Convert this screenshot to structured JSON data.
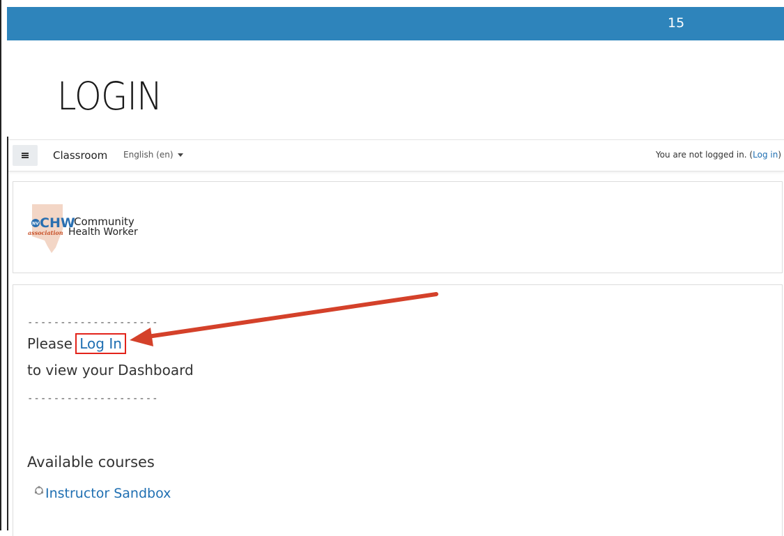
{
  "slide": {
    "number": "15",
    "title": "LOGIN",
    "accent_color": "#2e84bb"
  },
  "navbar": {
    "menu_icon": "hamburger-icon",
    "brand": "Classroom",
    "language": "English (en)",
    "status_text": "You are not logged in. (",
    "status_link": "Log in",
    "status_suffix": ")"
  },
  "logo": {
    "abbrev": "CHW",
    "badge": "NV",
    "tagline": "association",
    "line1": "Community",
    "line2": "Health Worker"
  },
  "main": {
    "dashes_top": "--------------------",
    "please": "Please",
    "login_link": "Log In",
    "dashboard": "to view your Dashboard",
    "dashes_bottom": "--------------------",
    "courses_heading": "Available courses",
    "course_icon": "course-icon",
    "courses": [
      {
        "name": "Instructor Sandbox"
      }
    ]
  },
  "annotation": {
    "arrow_color": "#d4412a",
    "highlight_color": "#e2231a"
  }
}
